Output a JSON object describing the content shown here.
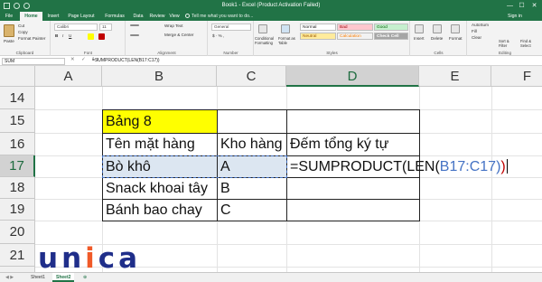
{
  "window": {
    "title": "Book1 - Excel (Product Activation Failed)",
    "controls": {
      "minimize": "—",
      "maximize": "☐",
      "close": "✕"
    }
  },
  "ribbon_tabs": [
    "File",
    "Home",
    "Insert",
    "Page Layout",
    "Formulas",
    "Data",
    "Review",
    "View"
  ],
  "tell_me": "Tell me what you want to do...",
  "sign_in": "Sign in",
  "ribbon": {
    "clipboard": {
      "paste": "Paste",
      "cut": "Cut",
      "copy": "Copy",
      "format_painter": "Format Painter",
      "label": "Clipboard"
    },
    "font": {
      "name": "Calibri",
      "size": "11",
      "label": "Font"
    },
    "alignment": {
      "wrap_text": "Wrap Text",
      "merge_center": "Merge & Center",
      "label": "Alignment"
    },
    "number": {
      "format": "General",
      "label": "Number"
    },
    "styles": {
      "conditional_formatting": "Conditional Formatting",
      "format_as_table": "Format as Table",
      "normal": "Normal",
      "bad": "Bad",
      "good": "Good",
      "neutral": "Neutral",
      "calculation": "Calculation",
      "check_cell": "Check Cell",
      "label": "Styles",
      "colors": {
        "bad_bg": "#ffc7ce",
        "good_bg": "#c6efce",
        "neutral_bg": "#ffeb9c",
        "calc_bg": "#f2f2f2",
        "check_bg": "#a5a5a5"
      }
    },
    "cells": {
      "insert": "Insert",
      "delete": "Delete",
      "format": "Format",
      "label": "Cells"
    },
    "editing": {
      "autosum": "AutoSum",
      "fill": "Fill",
      "clear": "Clear",
      "sort_filter": "Sort & Filter",
      "find_select": "Find & Select",
      "label": "Editing"
    }
  },
  "formula_bar": {
    "name_box": "SUM",
    "icons": "✕ ✓ fx",
    "formula": "=SUMPRODUCT(LEN(B17:C17))"
  },
  "sheet": {
    "columns": [
      "A",
      "B",
      "C",
      "D",
      "E",
      "F"
    ],
    "rows": [
      "14",
      "15",
      "16",
      "17",
      "18",
      "19",
      "20",
      "21",
      "22"
    ],
    "selected_column": "D",
    "selected_row": "17",
    "cells": {
      "B15": "Bảng 8",
      "B16": "Tên mặt hàng",
      "C16": "Kho hàng",
      "D16": "Đếm tổng ký tự",
      "B17": "Bò khô",
      "C17": "A",
      "B18": "Snack khoai tây",
      "C18": "B",
      "B19": "Bánh bao chay",
      "C19": "C"
    },
    "editing_formula": {
      "prefix": "=SUMPRODUCT(LEN(",
      "ref": "B17:C17",
      "close_inner": ")",
      "close_outer": ")"
    },
    "colors": {
      "header_yellow": "#ffff00",
      "selected_row_fill": "#dce6f1",
      "ref_blue": "#4472c4",
      "paren_red": "#c00000",
      "excel_green": "#217346"
    }
  },
  "sheet_tabs": [
    "Sheet1",
    "Sheet2"
  ],
  "active_sheet": "Sheet2",
  "logo": {
    "text_part1": "un",
    "text_highlight": "i",
    "text_part2": "ca"
  }
}
